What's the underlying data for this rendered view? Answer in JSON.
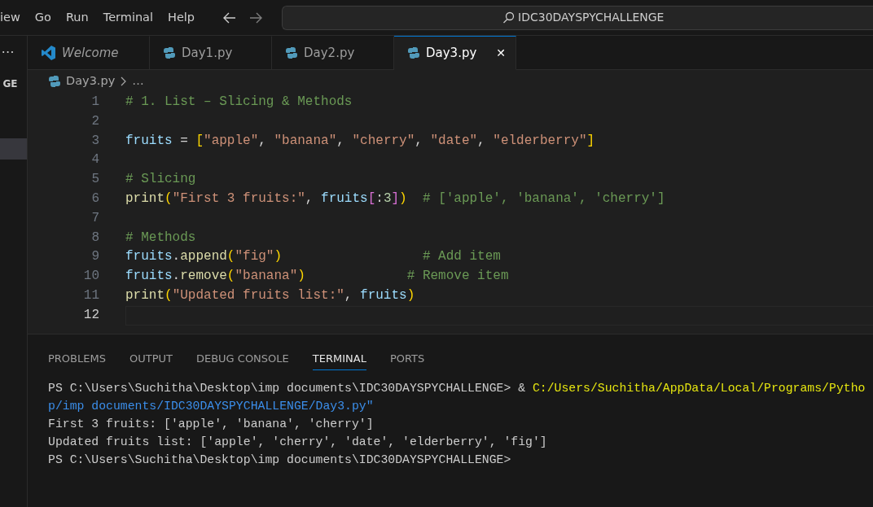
{
  "menu": [
    "iew",
    "Go",
    "Run",
    "Terminal",
    "Help"
  ],
  "search": {
    "value": "IDC30DAYSPYCHALLENGE"
  },
  "sidebar": {
    "menu": "⋯",
    "heading": "GE"
  },
  "tabs": [
    {
      "label": "Welcome",
      "kind": "welcome",
      "selected": false
    },
    {
      "label": "Day1.py",
      "kind": "python",
      "selected": false
    },
    {
      "label": "Day2.py",
      "kind": "python",
      "selected": false
    },
    {
      "label": "Day3.py",
      "kind": "python",
      "selected": true,
      "close": "✕"
    }
  ],
  "breadcrumb": {
    "file": "Day3.py",
    "rest": "…"
  },
  "code": [
    {
      "number": "1",
      "current": false,
      "tokens": [
        {
          "t": "# 1. List – Slicing & Methods",
          "kind": "comment"
        }
      ]
    },
    {
      "number": "2",
      "current": false
    },
    {
      "number": "3",
      "current": false,
      "tokens": [
        {
          "t": "fruits",
          "kind": "var"
        },
        {
          "t": " = ",
          "kind": "punct"
        },
        {
          "t": "[",
          "kind": "bracket"
        },
        {
          "t": "\"apple\"",
          "kind": "string"
        },
        {
          "t": ", ",
          "kind": "punct"
        },
        {
          "t": "\"banana\"",
          "kind": "string"
        },
        {
          "t": ", ",
          "kind": "punct"
        },
        {
          "t": "\"cherry\"",
          "kind": "string"
        },
        {
          "t": ", ",
          "kind": "punct"
        },
        {
          "t": "\"date\"",
          "kind": "string"
        },
        {
          "t": ", ",
          "kind": "punct"
        },
        {
          "t": "\"elderberry\"",
          "kind": "string"
        },
        {
          "t": "]",
          "kind": "bracket"
        }
      ]
    },
    {
      "number": "4",
      "current": false
    },
    {
      "number": "5",
      "current": false,
      "tokens": [
        {
          "t": "# Slicing",
          "kind": "comment"
        }
      ]
    },
    {
      "number": "6",
      "current": false,
      "tokens": [
        {
          "t": "print",
          "kind": "func"
        },
        {
          "t": "(",
          "kind": "bracket"
        },
        {
          "t": "\"First 3 fruits:\"",
          "kind": "string"
        },
        {
          "t": ", ",
          "kind": "punct"
        },
        {
          "t": "fruits",
          "kind": "var"
        },
        {
          "t": "[",
          "kind": "bracket2"
        },
        {
          "t": ":",
          "kind": "punct"
        },
        {
          "t": "3",
          "kind": "number"
        },
        {
          "t": "]",
          "kind": "bracket2"
        },
        {
          "t": ")",
          "kind": "bracket"
        },
        {
          "t": "  # ['apple', 'banana', 'cherry']",
          "kind": "comment"
        }
      ]
    },
    {
      "number": "7",
      "current": false
    },
    {
      "number": "8",
      "current": false,
      "tokens": [
        {
          "t": "# Methods",
          "kind": "comment"
        }
      ]
    },
    {
      "number": "9",
      "current": false,
      "tokens": [
        {
          "t": "fruits",
          "kind": "var"
        },
        {
          "t": ".",
          "kind": "punct"
        },
        {
          "t": "append",
          "kind": "func"
        },
        {
          "t": "(",
          "kind": "bracket"
        },
        {
          "t": "\"fig\"",
          "kind": "string"
        },
        {
          "t": ")",
          "kind": "bracket"
        },
        {
          "t": "                  # Add item",
          "kind": "comment"
        }
      ]
    },
    {
      "number": "10",
      "current": false,
      "tokens": [
        {
          "t": "fruits",
          "kind": "var"
        },
        {
          "t": ".",
          "kind": "punct"
        },
        {
          "t": "remove",
          "kind": "func"
        },
        {
          "t": "(",
          "kind": "bracket"
        },
        {
          "t": "\"banana\"",
          "kind": "string"
        },
        {
          "t": ")",
          "kind": "bracket"
        },
        {
          "t": "             # Remove item",
          "kind": "comment"
        }
      ]
    },
    {
      "number": "11",
      "current": false,
      "tokens": [
        {
          "t": "print",
          "kind": "func"
        },
        {
          "t": "(",
          "kind": "bracket"
        },
        {
          "t": "\"Updated fruits list:\"",
          "kind": "string"
        },
        {
          "t": ", ",
          "kind": "punct"
        },
        {
          "t": "fruits",
          "kind": "var"
        },
        {
          "t": ")",
          "kind": "bracket"
        }
      ]
    },
    {
      "number": "12",
      "current": true
    }
  ],
  "panel_tabs": [
    {
      "label": "PROBLEMS",
      "selected": false
    },
    {
      "label": "OUTPUT",
      "selected": false
    },
    {
      "label": "DEBUG CONSOLE",
      "selected": false
    },
    {
      "label": "TERMINAL",
      "selected": true
    },
    {
      "label": "PORTS",
      "selected": false
    }
  ],
  "terminal": [
    [
      {
        "t": "PS C:\\Users\\Suchitha\\Desktop\\imp documents\\IDC30DAYSPYCHALLENGE> & ",
        "kind": "plain"
      },
      {
        "t": "C:/Users/Suchitha/AppData/Local/Programs/Pytho",
        "kind": "command"
      }
    ],
    [
      {
        "t": "p/imp documents/IDC30DAYSPYCHALLENGE/Day3.py\"",
        "kind": "path"
      }
    ],
    [
      {
        "t": "First 3 fruits: ['apple', 'banana', 'cherry']",
        "kind": "plain"
      }
    ],
    [
      {
        "t": "Updated fruits list: ['apple', 'cherry', 'date', 'elderberry', 'fig']",
        "kind": "plain"
      }
    ],
    [
      {
        "t": "PS C:\\Users\\Suchitha\\Desktop\\imp documents\\IDC30DAYSPYCHALLENGE>",
        "kind": "plain"
      }
    ]
  ]
}
